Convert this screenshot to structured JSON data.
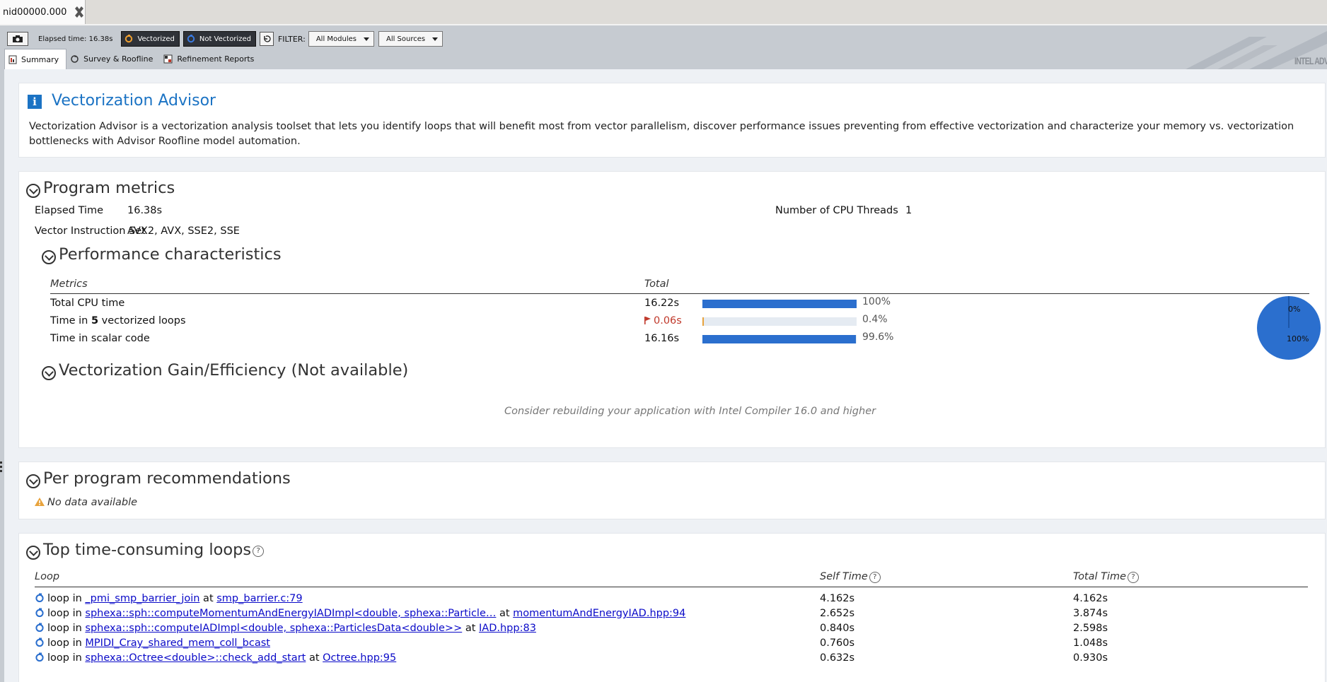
{
  "tabs": {
    "document_tab": "nid00000.000"
  },
  "toolbar": {
    "elapsed": "Elapsed time: 16.38s",
    "vectorized_label": "Vectorized",
    "not_vectorized_label": "Not Vectorized",
    "filter_label": "FILTER:",
    "modules_value": "All Modules",
    "sources_value": "All Sources"
  },
  "view_tabs": [
    "Summary",
    "Survey & Roofline",
    "Refinement Reports"
  ],
  "brand": "INTEL ADV",
  "header": {
    "title": "Vectorization Advisor",
    "description": "Vectorization Advisor is a vectorization analysis toolset that lets you identify loops that will benefit most from vector parallelism, discover performance issues preventing from effective vectorization and characterize your memory vs. vectorization bottlenecks with Advisor Roofline model automation."
  },
  "program_metrics": {
    "title": "Program metrics",
    "elapsed_label": "Elapsed Time",
    "elapsed_value": "16.38s",
    "threads_label": "Number of CPU Threads",
    "threads_value": "1",
    "isa_label": "Vector Instruction Set",
    "isa_value": "AVX2, AVX, SSE2, SSE",
    "perf_title": "Performance characteristics",
    "col_metrics": "Metrics",
    "col_total": "Total",
    "rows": [
      {
        "label": "Total CPU time",
        "value": "16.22s",
        "percent_text": "100%",
        "fraction": 1.0,
        "flag": false
      },
      {
        "label_pre": "Time in ",
        "label_bold": "5",
        "label_post": " vectorized loops",
        "value": "0.06s",
        "percent_text": "0.4%",
        "fraction": 0.004,
        "flag": true
      },
      {
        "label": "Time in scalar code",
        "value": "16.16s",
        "percent_text": "99.6%",
        "fraction": 0.996,
        "flag": false
      }
    ],
    "pie_labels": {
      "small": "0%",
      "large": "100%"
    },
    "gain_title": "Vectorization Gain/Efficiency (Not available)",
    "gain_note": "Consider rebuilding your application with Intel Compiler 16.0 and higher"
  },
  "recommendations": {
    "title": "Per program recommendations",
    "empty": "No data available"
  },
  "loops": {
    "title": "Top time-consuming loops",
    "col_loop": "Loop",
    "col_self": "Self Time",
    "col_total": "Total Time",
    "rows": [
      {
        "prefix": "loop in ",
        "func": "_pmi_smp_barrier_join",
        "at": " at ",
        "src": "smp_barrier.c:79",
        "self": "4.162s",
        "total": "4.162s"
      },
      {
        "prefix": "loop in ",
        "func": "sphexa::sph::computeMomentumAndEnergyIADImpl<double, sphexa::Particle…",
        "at": " at ",
        "src": "momentumAndEnergyIAD.hpp:94",
        "self": "2.652s",
        "total": "3.874s"
      },
      {
        "prefix": "loop in ",
        "func": "sphexa::sph::computeIADImpl<double, sphexa::ParticlesData<double>>",
        "at": " at ",
        "src": "IAD.hpp:83",
        "self": "0.840s",
        "total": "2.598s"
      },
      {
        "prefix": "loop in ",
        "func": "MPIDI_Cray_shared_mem_coll_bcast",
        "at": "",
        "src": "",
        "self": "0.760s",
        "total": "1.048s"
      },
      {
        "prefix": "loop in ",
        "func": "sphexa::Octree<double>::check_add_start",
        "at": " at ",
        "src": "Octree.hpp:95",
        "self": "0.632s",
        "total": "0.930s"
      }
    ]
  },
  "colors": {
    "accent": "#1b73c4",
    "bar": "#2b6fce",
    "flag": "#c0392b",
    "warning": "#e8a33d"
  }
}
